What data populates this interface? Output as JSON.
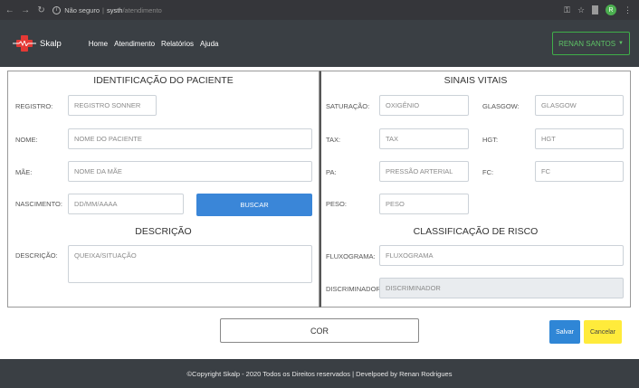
{
  "browser": {
    "security_label": "Não seguro",
    "url_host": "systh",
    "url_path": "/atendimento",
    "profile_initial": "R"
  },
  "navbar": {
    "brand": "Skalp",
    "links": [
      "Home",
      "Atendimento",
      "Relatórios",
      "Ajuda"
    ],
    "user": "RENAN SANTOS"
  },
  "patient": {
    "title": "IDENTIFICAÇÃO DO PACIENTE",
    "registro_label": "REGISTRO:",
    "registro_placeholder": "REGISTRO SONNER",
    "nome_label": "NOME:",
    "nome_placeholder": "NOME DO PACIENTE",
    "mae_label": "MÃE:",
    "mae_placeholder": "NOME DA MÃE",
    "nascimento_label": "NASCIMENTO:",
    "nascimento_placeholder": "DD/MM/AAAA",
    "buscar_label": "BUSCAR"
  },
  "description": {
    "title": "DESCRIÇÃO",
    "label": "DESCRIÇÃO:",
    "placeholder": "QUEIXA/SITUAÇÃO"
  },
  "vitals": {
    "title": "SINAIS VITAIS",
    "saturacao_label": "SATURAÇÃO:",
    "saturacao_placeholder": "OXIGÊNIO",
    "glasgow_label": "GLASGOW:",
    "glasgow_placeholder": "GLASGOW",
    "tax_label": "TAX:",
    "tax_placeholder": "TAX",
    "hgt_label": "HGT:",
    "hgt_placeholder": "HGT",
    "pa_label": "PA:",
    "pa_placeholder": "PRESSÃO ARTERIAL",
    "fc_label": "FC:",
    "fc_placeholder": "FC",
    "peso_label": "PESO:",
    "peso_placeholder": "PESO"
  },
  "risk": {
    "title": "CLASSIFICAÇÃO DE RISCO",
    "fluxograma_label": "FLUXOGRAMA:",
    "fluxograma_placeholder": "FLUXOGRAMA",
    "discriminador_label": "DISCRIMINADOR:",
    "discriminador_placeholder": "DISCRIMINADOR"
  },
  "actions": {
    "cor_label": "COR",
    "salvar_label": "Salvar",
    "cancelar_label": "Cancelar"
  },
  "footer": {
    "text": "©Copyright Skalp - 2020 Todos os Direitos reservados | Develpoed by Renan Rodrigues"
  },
  "colors": {
    "navbar_bg": "#3a3f44",
    "brand_red": "#e53935",
    "user_green": "#3fae49",
    "buscar_blue": "#3a86d8",
    "salvar_blue": "#2f86d6",
    "cancelar_yellow": "#ffeb3b"
  }
}
